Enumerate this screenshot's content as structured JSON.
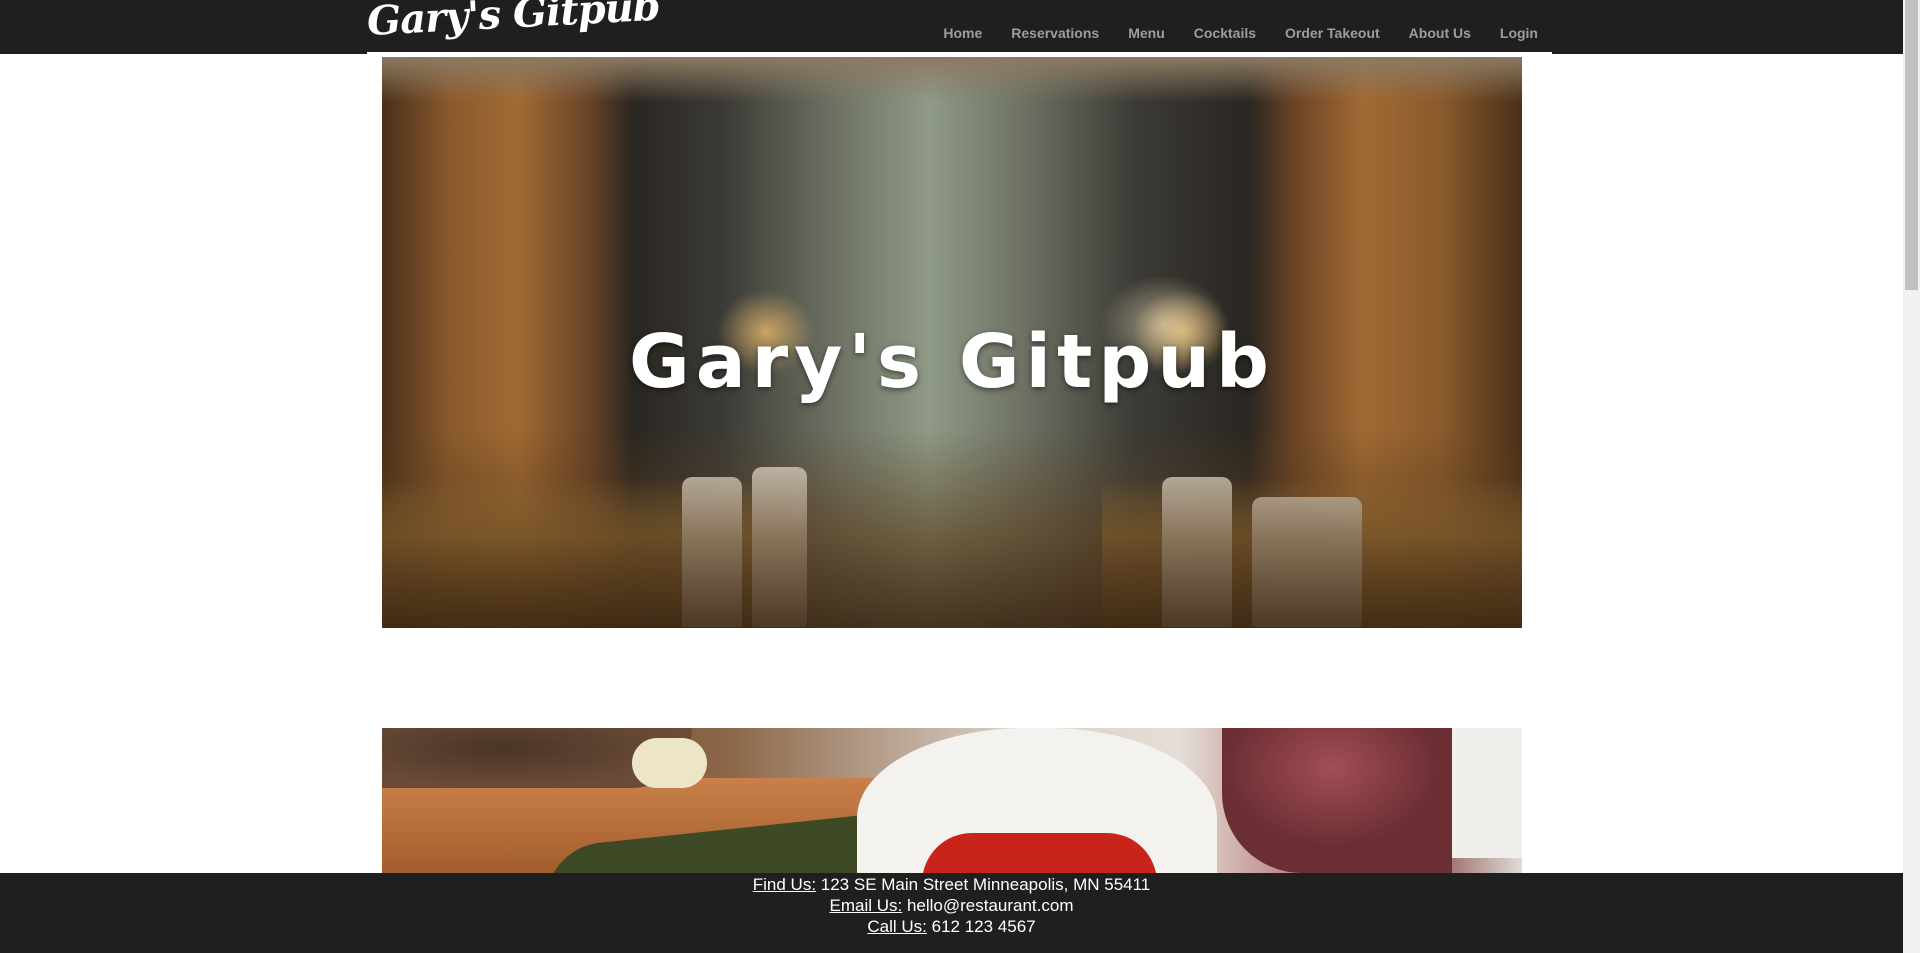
{
  "navbar": {
    "brand": "Gary's Gitpub",
    "links": [
      {
        "label": "Home"
      },
      {
        "label": "Reservations"
      },
      {
        "label": "Menu"
      },
      {
        "label": "Cocktails"
      },
      {
        "label": "Order Takeout"
      },
      {
        "label": "About Us"
      },
      {
        "label": "Login"
      }
    ]
  },
  "hero": {
    "title": "Gary's Gitpub"
  },
  "footer": {
    "find_label": "Find Us:",
    "find_value": " 123 SE Main Street Minneapolis, MN 55411",
    "email_label": "Email Us:",
    "email_value": " hello@restaurant.com",
    "call_label": "Call Us:",
    "call_value": " 612 123 4567"
  },
  "colors": {
    "navbar_bg": "#1f1f1f",
    "nav_link": "#9d9d9d",
    "footer_bg": "#1f1f1f"
  }
}
